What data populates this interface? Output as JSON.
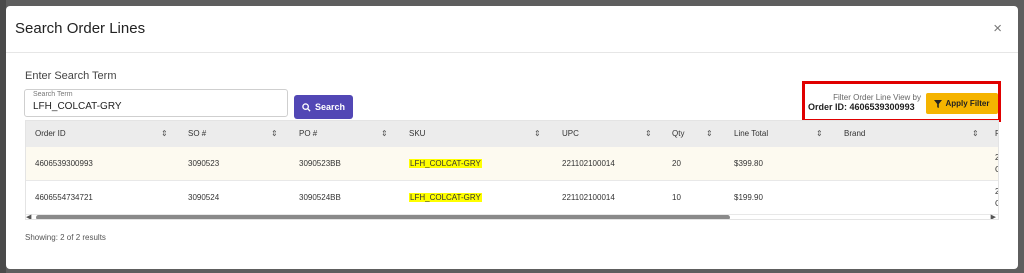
{
  "modal": {
    "title": "Search Order Lines",
    "close_glyph": "×"
  },
  "search": {
    "heading": "Enter Search Term",
    "field_label": "Search Term",
    "value": "LFH_COLCAT-GRY",
    "button_label": "Search",
    "button_icon": "search-icon"
  },
  "filter": {
    "line1": "Filter Order Line View by",
    "line2": "Order ID: 4606539300993",
    "button_label": "Apply Filter",
    "button_icon": "funnel-icon"
  },
  "table": {
    "columns": [
      "Order ID",
      "SO #",
      "PO #",
      "SKU",
      "UPC",
      "Qty",
      "Line Total",
      "Brand",
      "F"
    ],
    "rows": [
      {
        "order_id": "4606539300993",
        "so": "3090523",
        "po": "3090523BB",
        "sku": "LFH_COLCAT-GRY",
        "upc": "221102100014",
        "qty": "20",
        "line_total": "$399.80",
        "brand": "",
        "extra1": "2",
        "extra2": "C"
      },
      {
        "order_id": "4606554734721",
        "so": "3090524",
        "po": "3090524BB",
        "sku": "LFH_COLCAT-GRY",
        "upc": "221102100014",
        "qty": "10",
        "line_total": "$199.90",
        "brand": "",
        "extra1": "2",
        "extra2": "C"
      }
    ]
  },
  "footer": {
    "showing": "Showing: 2 of 2 results"
  },
  "colors": {
    "primary_button": "#5247b5",
    "apply_button": "#f5b400",
    "highlight_border": "#e00000",
    "sku_highlight": "#ffff00"
  }
}
